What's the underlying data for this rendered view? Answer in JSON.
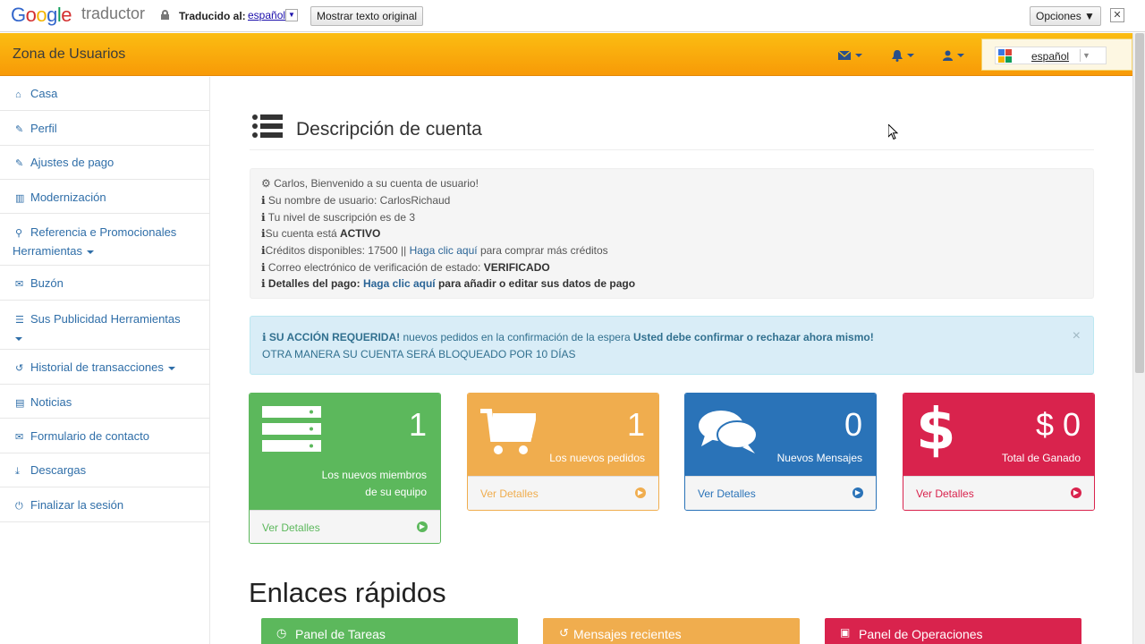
{
  "translate_bar": {
    "logo_letters": [
      "G",
      "o",
      "o",
      "g",
      "l",
      "e"
    ],
    "product": "traductor",
    "translated_label": "Traducido al:",
    "language": "español",
    "show_original_label": "Mostrar texto original",
    "options_label": "Opciones ▼",
    "close_glyph": "✕"
  },
  "header": {
    "brand": "Zona de Usuarios",
    "icons": [
      "envelope-icon",
      "bell-icon",
      "user-icon"
    ],
    "language_select": "español"
  },
  "sidebar": {
    "items": [
      {
        "label": "Casa",
        "icon": "home-icon"
      },
      {
        "label": "Perfil",
        "icon": "wrench-icon"
      },
      {
        "label": "Ajustes de pago",
        "icon": "wrench-icon"
      },
      {
        "label": "Modernización",
        "icon": "bar-chart-icon"
      },
      {
        "label": "Referencia e Promocionales",
        "label2": "Herramientas",
        "icon": "sitemap-icon"
      },
      {
        "label": "Buzón",
        "icon": "envelope-icon"
      },
      {
        "label": "Sus Publicidad Herramientas",
        "icon": "list-icon"
      },
      {
        "label": "Historial de transacciones",
        "icon": "history-icon"
      },
      {
        "label": "Noticias",
        "icon": "newspaper-icon"
      },
      {
        "label": "Formulario de contacto",
        "icon": "envelope-icon"
      },
      {
        "label": "Descargas",
        "icon": "download-icon"
      },
      {
        "label": "Finalizar la sesión",
        "icon": "power-icon"
      }
    ]
  },
  "main": {
    "title": "Descripción de cuenta",
    "welcome": {
      "line1": "Carlos, Bienvenido a su cuenta de usuario!",
      "line2": "Su nombre de usuario: CarlosRichaud",
      "line3": "Tu nivel de suscripción es de 3",
      "line4_prefix": "Su cuenta está ",
      "line4_status": "ACTIVO",
      "line5_prefix": "Créditos disponibles: 17500 || ",
      "line5_link": "Haga clic aquí",
      "line5_suffix": " para comprar más créditos",
      "line6_prefix": "Correo electrónico de verificación de estado: ",
      "line6_status": "VERIFICADO",
      "line7_prefix": "Detalles del pago: ",
      "line7_link": "Haga clic aquí",
      "line7_suffix": " para añadir o editar sus datos de pago"
    },
    "alert": {
      "strong": "SU ACCIÓN REQUERIDA!",
      "text": " nuevos pedidos en la confirmación de la espera ",
      "strong2": "Usted debe confirmar o rechazar ahora mismo!",
      "line2": "OTRA MANERA SU CUENTA SERÁ BLOQUEADO POR 10 DÍAS",
      "close": "×"
    },
    "panels": [
      {
        "number": "1",
        "label1": "Los nuevos miembros",
        "label2": "de su equipo",
        "footer": "Ver Detalles",
        "color": "#5cb85c"
      },
      {
        "number": "1",
        "label1": "Los nuevos pedidos",
        "footer": "Ver Detalles",
        "color": "#f0ad4e"
      },
      {
        "number": "0",
        "label1": "Nuevos Mensajes",
        "footer": "Ver Detalles",
        "color": "#2a73b8"
      },
      {
        "number": "$ 0",
        "label1": "Total de Ganado",
        "footer": "Ver Detalles",
        "color": "#d9234d"
      }
    ],
    "quick_links_title": "Enlaces rápidos",
    "quick_links": [
      {
        "label": "Panel de Tareas",
        "icon": "clock-icon",
        "color": "#5cb85c"
      },
      {
        "label": "Mensajes recientes",
        "icon": "refresh-icon",
        "color": "#f0ad4e"
      },
      {
        "label": "Panel de Operaciones",
        "icon": "money-icon",
        "color": "#d9234d"
      }
    ]
  }
}
